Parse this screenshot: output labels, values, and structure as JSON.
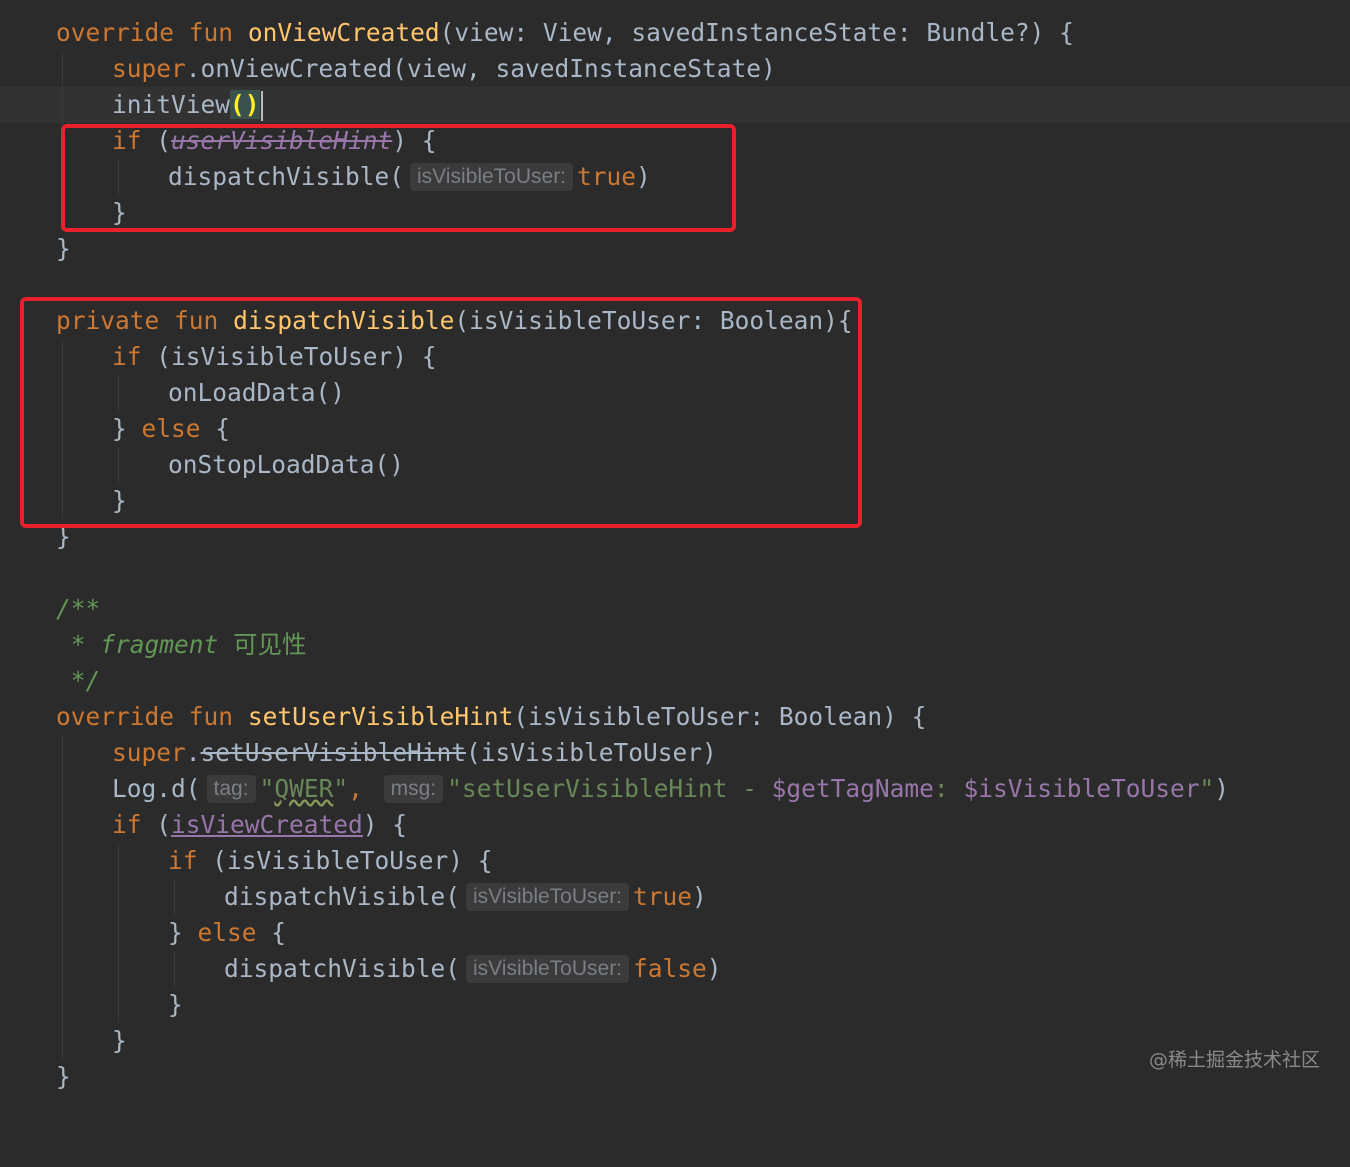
{
  "code": {
    "l1": {
      "kw1": "override",
      "kw2": "fun",
      "fn": "onViewCreated",
      "rest": "(view: View, savedInstanceState: Bundle?) {"
    },
    "l2": {
      "kw": "super",
      "rest": ".onViewCreated(view, savedInstanceState)"
    },
    "l3": {
      "call": "initView",
      "parens": "()"
    },
    "l4": {
      "kw": "if",
      "open": " (",
      "prop": "userVisibleHint",
      "close": ") {"
    },
    "l5": {
      "call": "dispatchVisible(",
      "hint": "isVisibleToUser:",
      "value": "true",
      "close": ")"
    },
    "l6": {
      "brace": "}"
    },
    "l7": {
      "brace": "}"
    },
    "l9": {
      "kw1": "private",
      "kw2": "fun",
      "fn": "dispatchVisible",
      "rest": "(isVisibleToUser: Boolean){"
    },
    "l10": {
      "kw": "if",
      "rest": " (isVisibleToUser) {"
    },
    "l11": {
      "call": "onLoadData()"
    },
    "l12": {
      "open": "} ",
      "kw": "else",
      "close": " {"
    },
    "l13": {
      "call": "onStopLoadData()"
    },
    "l14": {
      "brace": "}"
    },
    "l15": {
      "brace": "}"
    },
    "l17": {
      "text": "/**"
    },
    "l18": {
      "star": " * ",
      "word": "fragment",
      "zh": "可见性"
    },
    "l19": {
      "text": " */"
    },
    "l20": {
      "kw1": "override",
      "kw2": "fun",
      "fn": "setUserVisibleHint",
      "rest": "(isVisibleToUser: Boolean) {"
    },
    "l21": {
      "kw": "super",
      "dot": ".",
      "deprecated": "setUserVisibleHint",
      "rest": "(isVisibleToUser)"
    },
    "l22": {
      "call": "Log.d(",
      "hint1": "tag:",
      "q1": "\"",
      "tag": "QWER",
      "q2": "\"",
      "comma": ",",
      "hint2": "msg:",
      "s1": "\"setUserVisibleHint - ",
      "t1": "$getTagName",
      "s2": ": ",
      "t2": "$isVisibleToUser",
      "s3": "\"",
      "close": ")"
    },
    "l23": {
      "kw": "if",
      "open": " (",
      "prop": "isViewCreated",
      "close": ") {"
    },
    "l24": {
      "kw": "if",
      "rest": " (isVisibleToUser) {"
    },
    "l25": {
      "call": "dispatchVisible(",
      "hint": "isVisibleToUser:",
      "value": "true",
      "close": ")"
    },
    "l26": {
      "open": "} ",
      "kw": "else",
      "close": " {"
    },
    "l27": {
      "call": "dispatchVisible(",
      "hint": "isVisibleToUser:",
      "value": "false",
      "close": ")"
    },
    "l28": {
      "brace": "}"
    },
    "l29": {
      "brace": "}"
    },
    "l30": {
      "brace": "}"
    }
  },
  "watermark": "@稀土掘金技术社区",
  "colors": {
    "background": "#2b2b2b",
    "keyword": "#cc7832",
    "function": "#ffc66d",
    "string": "#6a8759",
    "property": "#9876aa",
    "comment": "#629755",
    "highlight_box": "#e8212d"
  }
}
